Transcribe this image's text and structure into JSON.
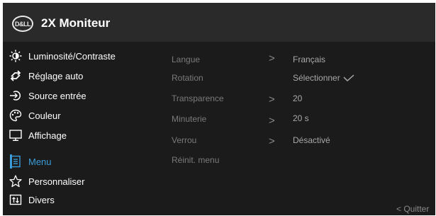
{
  "header": {
    "logo_text": "D&LL",
    "title": "2X Moniteur"
  },
  "menu": {
    "items": [
      {
        "label": "Luminosité/Contraste",
        "icon": "brightness-icon"
      },
      {
        "label": "Réglage auto",
        "icon": "auto-adjust-icon"
      },
      {
        "label": "Source entrée",
        "icon": "input-source-icon"
      },
      {
        "label": "Couleur",
        "icon": "color-palette-icon"
      },
      {
        "label": "Affichage",
        "icon": "display-monitor-icon"
      },
      {
        "label": "Menu",
        "icon": "menu-document-icon",
        "selected": true
      },
      {
        "label": "Personnaliser",
        "icon": "star-icon"
      },
      {
        "label": "Divers",
        "icon": "others-info-icon"
      }
    ]
  },
  "submenu": {
    "rows": [
      {
        "label": "Langue",
        "arrow": ">",
        "value": "Français"
      },
      {
        "label": "Rotation",
        "arrow": "",
        "value": "Sélectionner"
      },
      {
        "label": "Transparence",
        "arrow": ">",
        "value": "20"
      },
      {
        "label": "Minuterie",
        "arrow": ">",
        "value": "20 s"
      },
      {
        "label": "Verrou",
        "arrow": ">",
        "value": "Désactivé"
      },
      {
        "label": "Réinit. menu",
        "arrow": "",
        "value": ""
      }
    ]
  },
  "footer": {
    "quit_label": "< Quitter"
  },
  "colors": {
    "accent": "#3a9cd9",
    "background": "#1b1b1b",
    "header": "#2a2a2a"
  }
}
